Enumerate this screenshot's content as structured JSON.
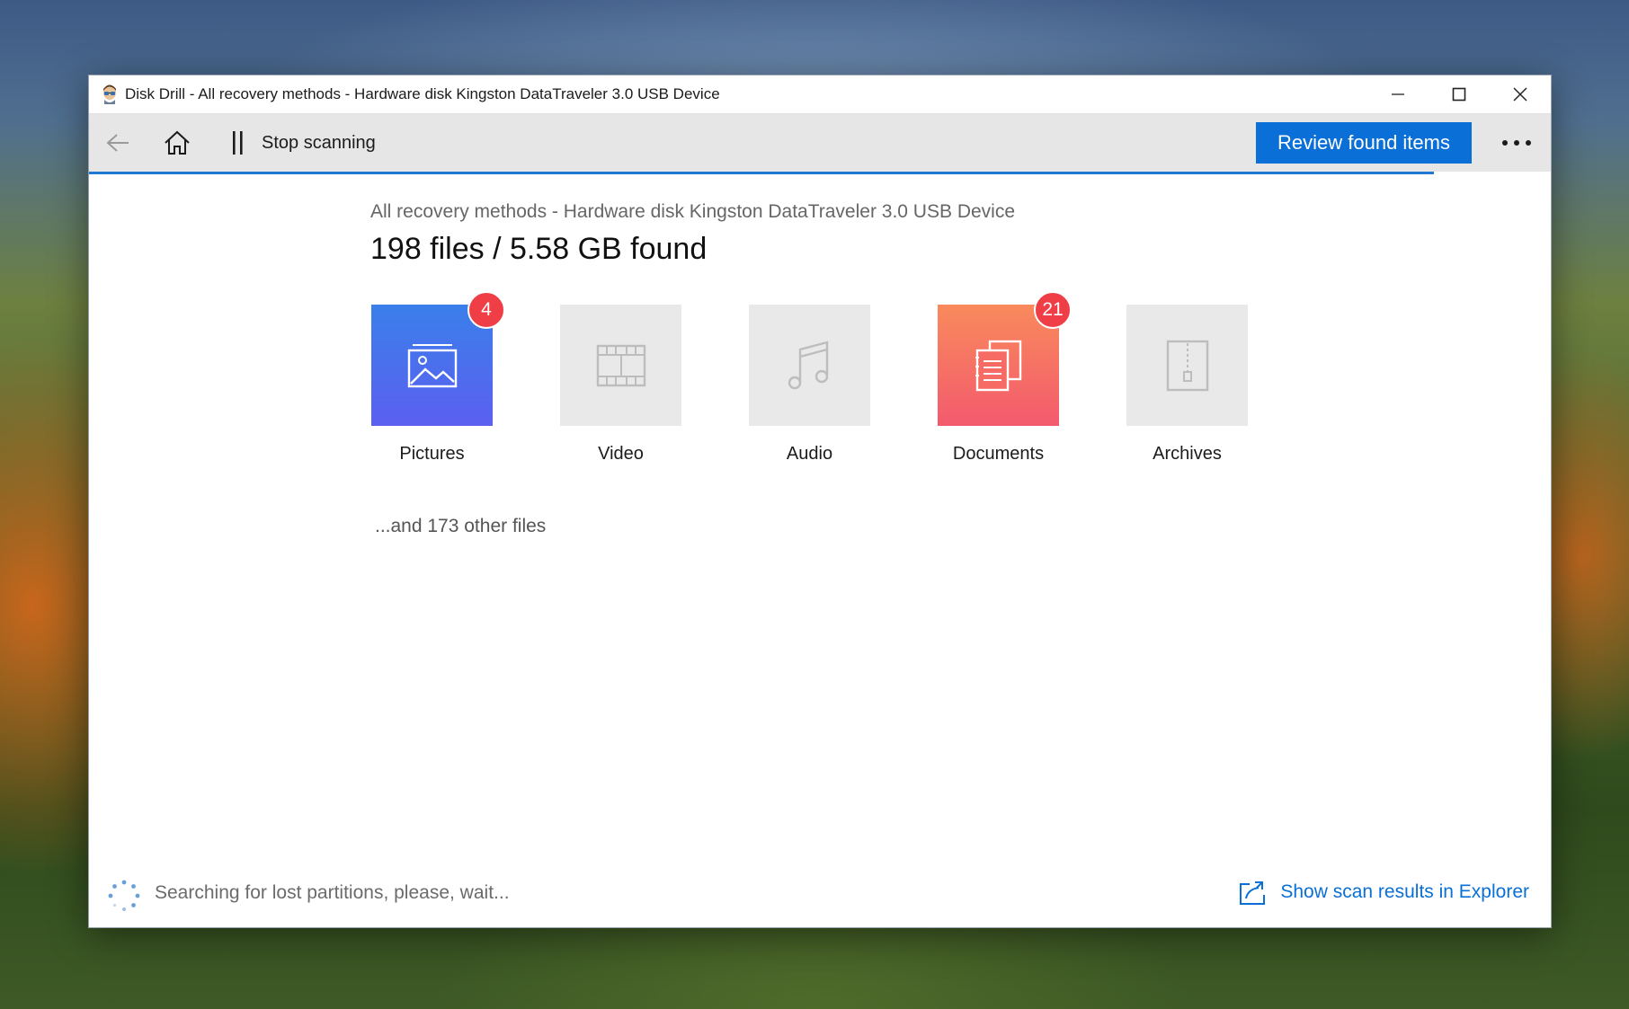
{
  "window": {
    "title": "Disk Drill - All recovery methods - Hardware disk Kingston DataTraveler 3.0 USB Device"
  },
  "toolbar": {
    "stop_label": "Stop scanning",
    "review_label": "Review found items"
  },
  "scan": {
    "progress_percent": 92,
    "subtitle": "All recovery methods - Hardware disk Kingston DataTraveler 3.0 USB Device",
    "headline": "198 files / 5.58 GB found",
    "other_files": "...and 173 other files"
  },
  "categories": [
    {
      "label": "Pictures",
      "badge": "4",
      "icon": "image-icon",
      "active": true,
      "color": "#4a6ff0"
    },
    {
      "label": "Video",
      "badge": "",
      "icon": "film-icon",
      "active": false
    },
    {
      "label": "Audio",
      "badge": "",
      "icon": "music-note-icon",
      "active": false
    },
    {
      "label": "Documents",
      "badge": "21",
      "icon": "documents-icon",
      "active": true,
      "color": "#f66c64"
    },
    {
      "label": "Archives",
      "badge": "",
      "icon": "archive-zipper-icon",
      "active": false
    }
  ],
  "status": {
    "text": "Searching for lost partitions, please, wait...",
    "explorer_label": "Show scan results in Explorer"
  },
  "colors": {
    "accent": "#0a6fd6",
    "badge": "#ef3e46"
  }
}
